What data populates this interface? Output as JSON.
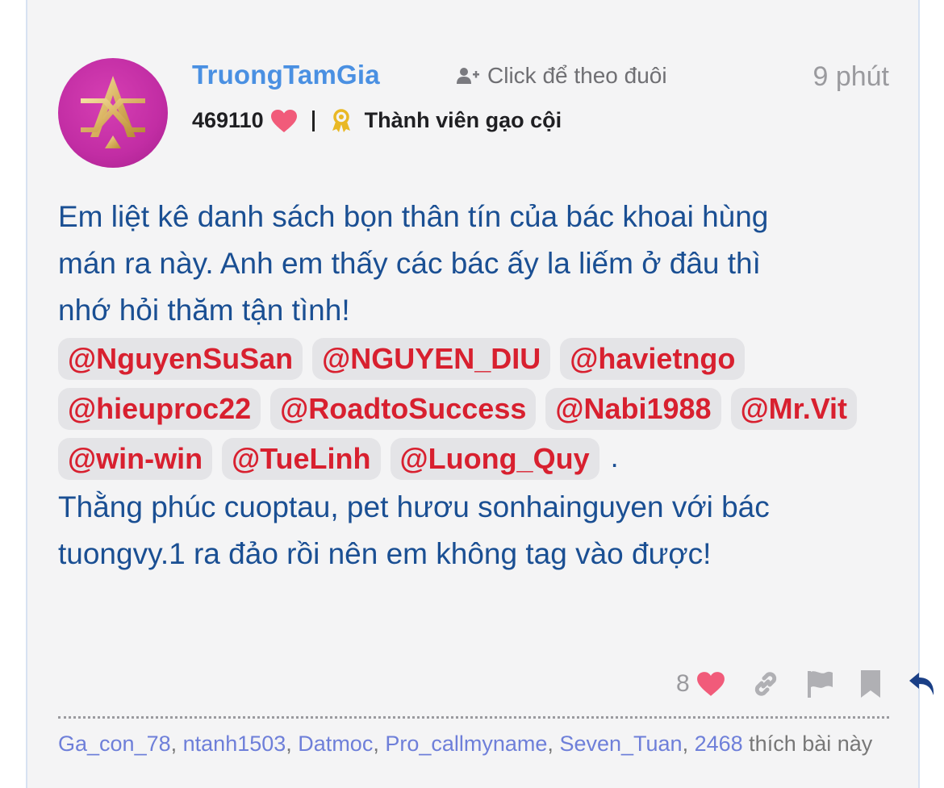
{
  "post": {
    "username": "TruongTamGia",
    "follow_label": "Click để theo đuôi",
    "time": "9 phút",
    "reputation": "469110",
    "rank": "Thành viên gạo cội",
    "body_line1": "Em liệt kê danh sách bọn thân tín của bác khoai hùng",
    "body_line2": "mán ra này. Anh em thấy các bác ấy la liếm ở đâu thì",
    "body_line3": "nhớ hỏi thăm tận tình!",
    "mentions": [
      "@NguyenSuSan",
      "@NGUYEN_DIU",
      "@havietngo",
      "@hieuproc22",
      "@RoadtoSuccess",
      "@Nabi1988",
      "@Mr.Vit",
      "@win-win",
      "@TueLinh",
      "@Luong_Quy"
    ],
    "mention_end": ".",
    "body_line4": "Thằng phúc cuoptau, pet hươu sonhainguyen với bác",
    "body_line5": "tuongvy.1 ra đảo rồi nên em không tag vào được!",
    "like_count": "8",
    "likers": [
      "Ga_con_78",
      "ntanh1503",
      "Datmoc",
      "Pro_callmyname",
      "Seven_Tuan",
      "2468"
    ],
    "likers_suffix": "thích",
    "likers_suffix2": "bài này"
  },
  "icons": {
    "follow": "add-user-icon",
    "reputation": "heart-icon",
    "rank": "award-ribbon-icon",
    "like": "heart-icon",
    "link": "link-icon",
    "report": "flag-icon",
    "bookmark": "bookmark-icon",
    "reply": "reply-icon"
  },
  "colors": {
    "username": "#4a90e2",
    "body": "#1a4f93",
    "mention": "#d8202f",
    "heart": "#f15b7a",
    "avatar": "#c22da4"
  }
}
